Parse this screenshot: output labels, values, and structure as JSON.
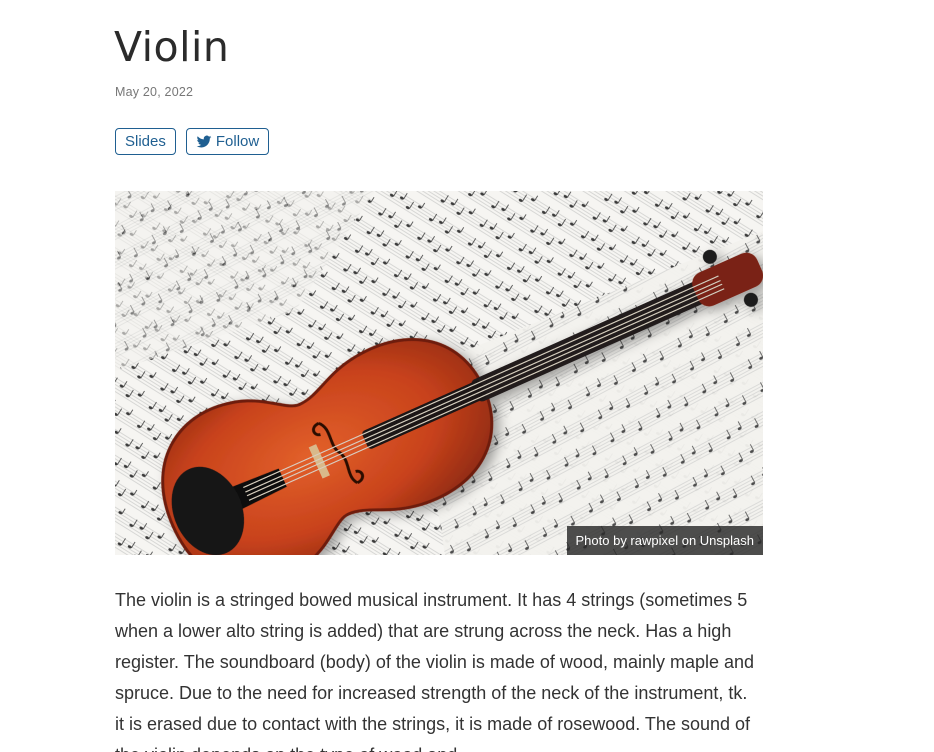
{
  "article": {
    "title": "Violin",
    "date": "May 20, 2022",
    "buttons": {
      "slides": "Slides",
      "follow": "Follow",
      "follow_icon": "twitter-icon"
    },
    "image": {
      "subject": "violin-on-sheet-music",
      "caption": "Photo by rawpixel on Unsplash"
    },
    "body": "The violin is a stringed bowed musical instrument. It has 4 strings (sometimes 5 when a lower alto string is added) that are strung across the neck. Has a high register. The soundboard (body) of the violin is made of wood, mainly maple and spruce. Due to the need for increased strength of the neck of the instrument, tk. it is erased due to contact with the strings, it is made of rosewood. The sound of the violin depends on the type of wood and"
  },
  "colors": {
    "accent": "#1f5f91",
    "text": "#333333",
    "muted": "#777777",
    "violin_body": "#c8421c"
  }
}
